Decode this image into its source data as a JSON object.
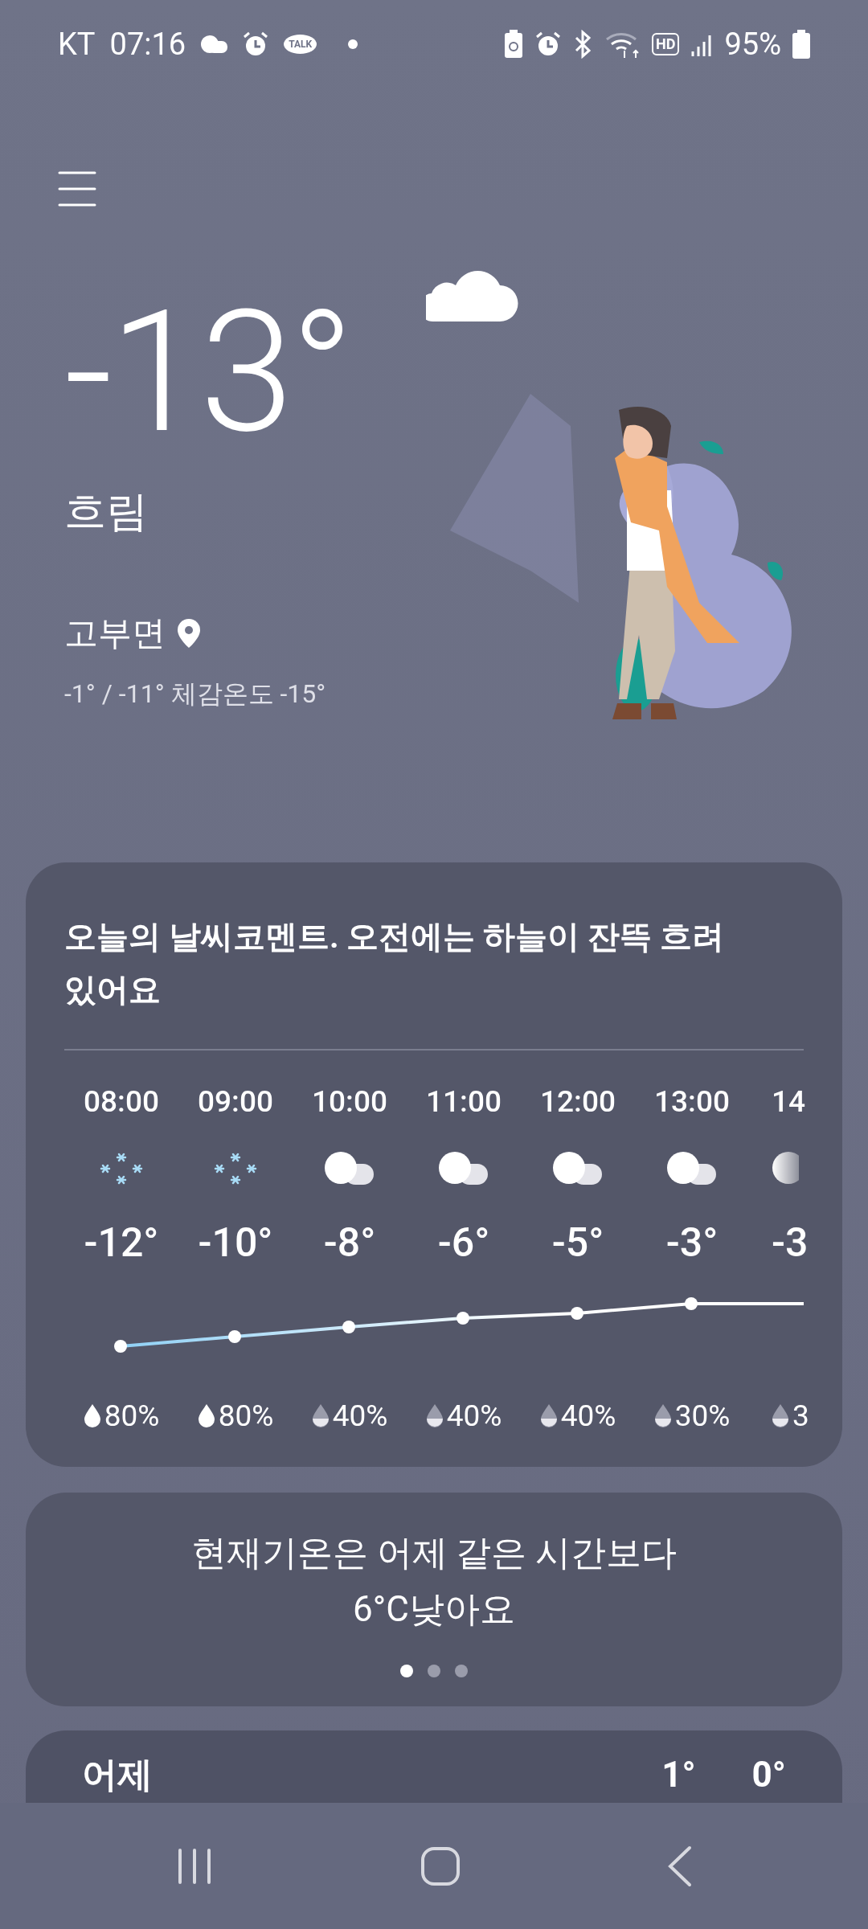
{
  "status_bar": {
    "carrier": "KT",
    "time": "07:16",
    "talk_label": "TALK",
    "hd_label": "HD",
    "battery": "95%"
  },
  "current": {
    "temperature": "-13°",
    "condition": "흐림",
    "location": "고부면",
    "details": "-1° / -11° 체감온도 -15°"
  },
  "forecast_card": {
    "comment": "오늘의 날씨코멘트. 오전에는 하늘이 잔뜩 흐려있어요",
    "hours": [
      {
        "time": "08:00",
        "kind": "snow",
        "temp": "-12°",
        "precipitation": {
          "kind": "full",
          "value": "80%"
        }
      },
      {
        "time": "09:00",
        "kind": "snow",
        "temp": "-10°",
        "precipitation": {
          "kind": "full",
          "value": "80%"
        }
      },
      {
        "time": "10:00",
        "kind": "cloudy",
        "temp": "-8°",
        "precipitation": {
          "kind": "half",
          "value": "40%"
        }
      },
      {
        "time": "11:00",
        "kind": "cloudy",
        "temp": "-6°",
        "precipitation": {
          "kind": "half",
          "value": "40%"
        }
      },
      {
        "time": "12:00",
        "kind": "cloudy",
        "temp": "-5°",
        "precipitation": {
          "kind": "half",
          "value": "40%"
        }
      },
      {
        "time": "13:00",
        "kind": "cloudy",
        "temp": "-3°",
        "precipitation": {
          "kind": "half",
          "value": "30%"
        }
      },
      {
        "time": "14",
        "kind": "partial",
        "temp": "-3",
        "precipitation": {
          "kind": "half",
          "value": "3"
        }
      }
    ]
  },
  "comparison_card": {
    "text": "현재기온은 어제 같은 시간보다\n6°C낮아요",
    "pages": [
      {
        "selected": true
      },
      {
        "selected": false
      },
      {
        "selected": false
      }
    ]
  },
  "yesterday_card": {
    "label": "어제",
    "high": "1°",
    "low": "0°"
  }
}
